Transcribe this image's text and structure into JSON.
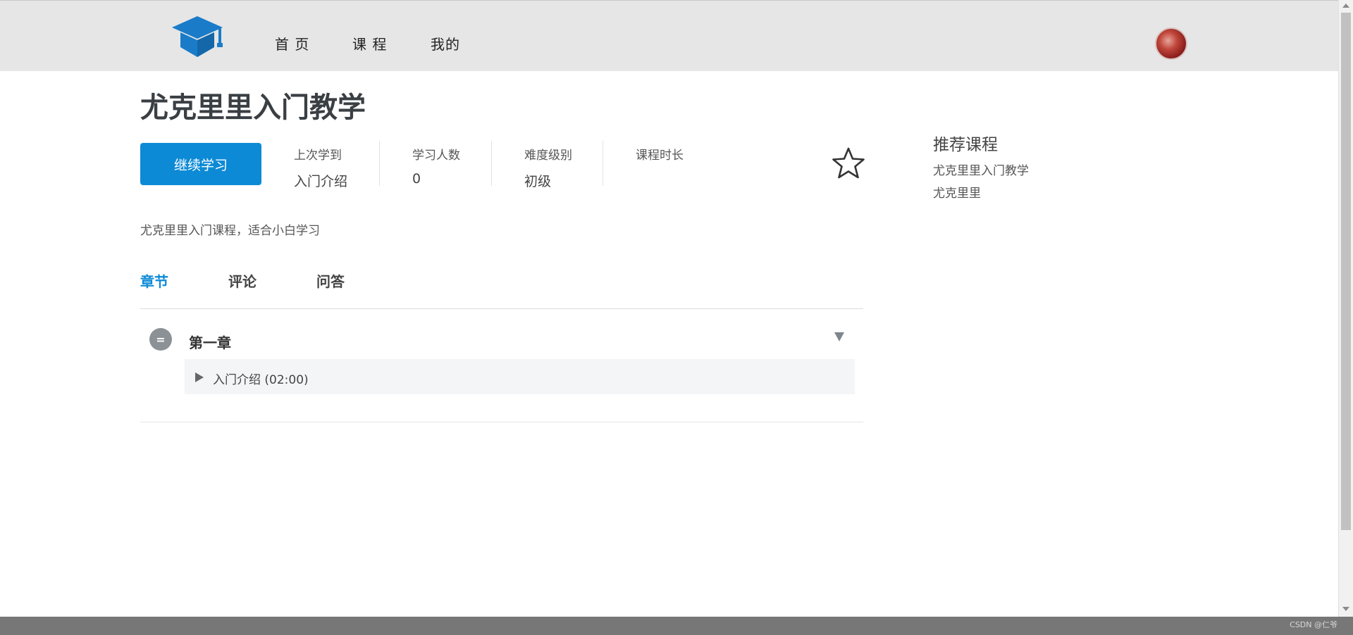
{
  "nav": {
    "items": [
      "首 页",
      "课 程",
      "我的"
    ]
  },
  "course": {
    "title": "尤克里里入门教学",
    "continue_label": "继续学习",
    "stats": [
      {
        "label": "上次学到",
        "value": "入门介绍"
      },
      {
        "label": "学习人数",
        "value": "0"
      },
      {
        "label": "难度级别",
        "value": "初级"
      },
      {
        "label": "课程时长",
        "value": ""
      }
    ],
    "description": "尤克里里入门课程，适合小白学习"
  },
  "tabs": [
    "章节",
    "评论",
    "问答"
  ],
  "active_tab": "章节",
  "chapters": [
    {
      "icon_text": "=",
      "title": "第一章",
      "lessons": [
        "入门介绍 (02:00)"
      ]
    }
  ],
  "recommend": {
    "title": "推荐课程",
    "items": [
      "尤克里里入门教学",
      "尤克里里"
    ]
  },
  "footer": {
    "watermark": "CSDN @仁爷"
  },
  "colors": {
    "accent": "#0d8ad6",
    "header_bg": "#e6e6e6",
    "footer_bg": "#777777"
  },
  "icons": {
    "logo": "graduation-cap-icon",
    "favorite": "star-outline-icon",
    "chapter": "equals-circle-icon",
    "toggle": "triangle-down-icon",
    "lesson": "play-icon"
  }
}
